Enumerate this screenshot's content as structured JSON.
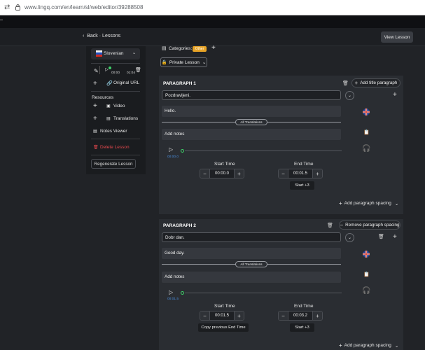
{
  "browser": {
    "url": "www.lingq.com/en/learn/sl/web/editor/39288508"
  },
  "header": {
    "back_label": "Back",
    "separator": "·",
    "section_label": "Lessons",
    "view_lesson_label": "View Lesson"
  },
  "sidebar": {
    "language_label": "Slovenian",
    "audio_time_start": "00:00",
    "audio_time_end": "01:04",
    "original_url_label": "Original URL",
    "resources_label": "Resources",
    "video_label": "Video",
    "translations_label": "Translations",
    "notes_viewer_label": "Notes Viewer",
    "delete_lesson_label": "Delete Lesson",
    "regenerate_label": "Regenerate Lesson"
  },
  "main": {
    "categories_label": "Categories:",
    "category_badge": "Other",
    "private_lesson_label": "Private Lesson",
    "add_title_paragraph_label": "Add title paragraph",
    "remove_spacing_label": "Remove paragraph spacing",
    "add_spacing_label": "Add paragraph spacing",
    "paragraphs": [
      {
        "title": "PARAGRAPH 1",
        "text": "Pozdravljeni.",
        "translation": "Hello.",
        "translations_button": "All Translations",
        "notes_placeholder": "Add notes",
        "current_time": "00:00.0",
        "start_label": "Start Time",
        "start_value": "00:00.0",
        "end_label": "End Time",
        "end_value": "00:01.5",
        "start_plus": "Start +3"
      },
      {
        "title": "PARAGRAPH 2",
        "text": "Dobr dan.",
        "translation": "Good day.",
        "translations_button": "All Translations",
        "notes_placeholder": "Add notes",
        "current_time": "00:01.5",
        "start_label": "Start Time",
        "start_value": "00:01.5",
        "end_label": "End Time",
        "end_value": "00:03.2",
        "copy_label": "Copy previous End Time",
        "start_plus": "Start +3"
      }
    ]
  },
  "colors": {
    "accent_green": "#3fd26a",
    "delete_red": "#e5484d",
    "time_blue": "#4a90e2",
    "badge_orange": "#e8a427"
  }
}
